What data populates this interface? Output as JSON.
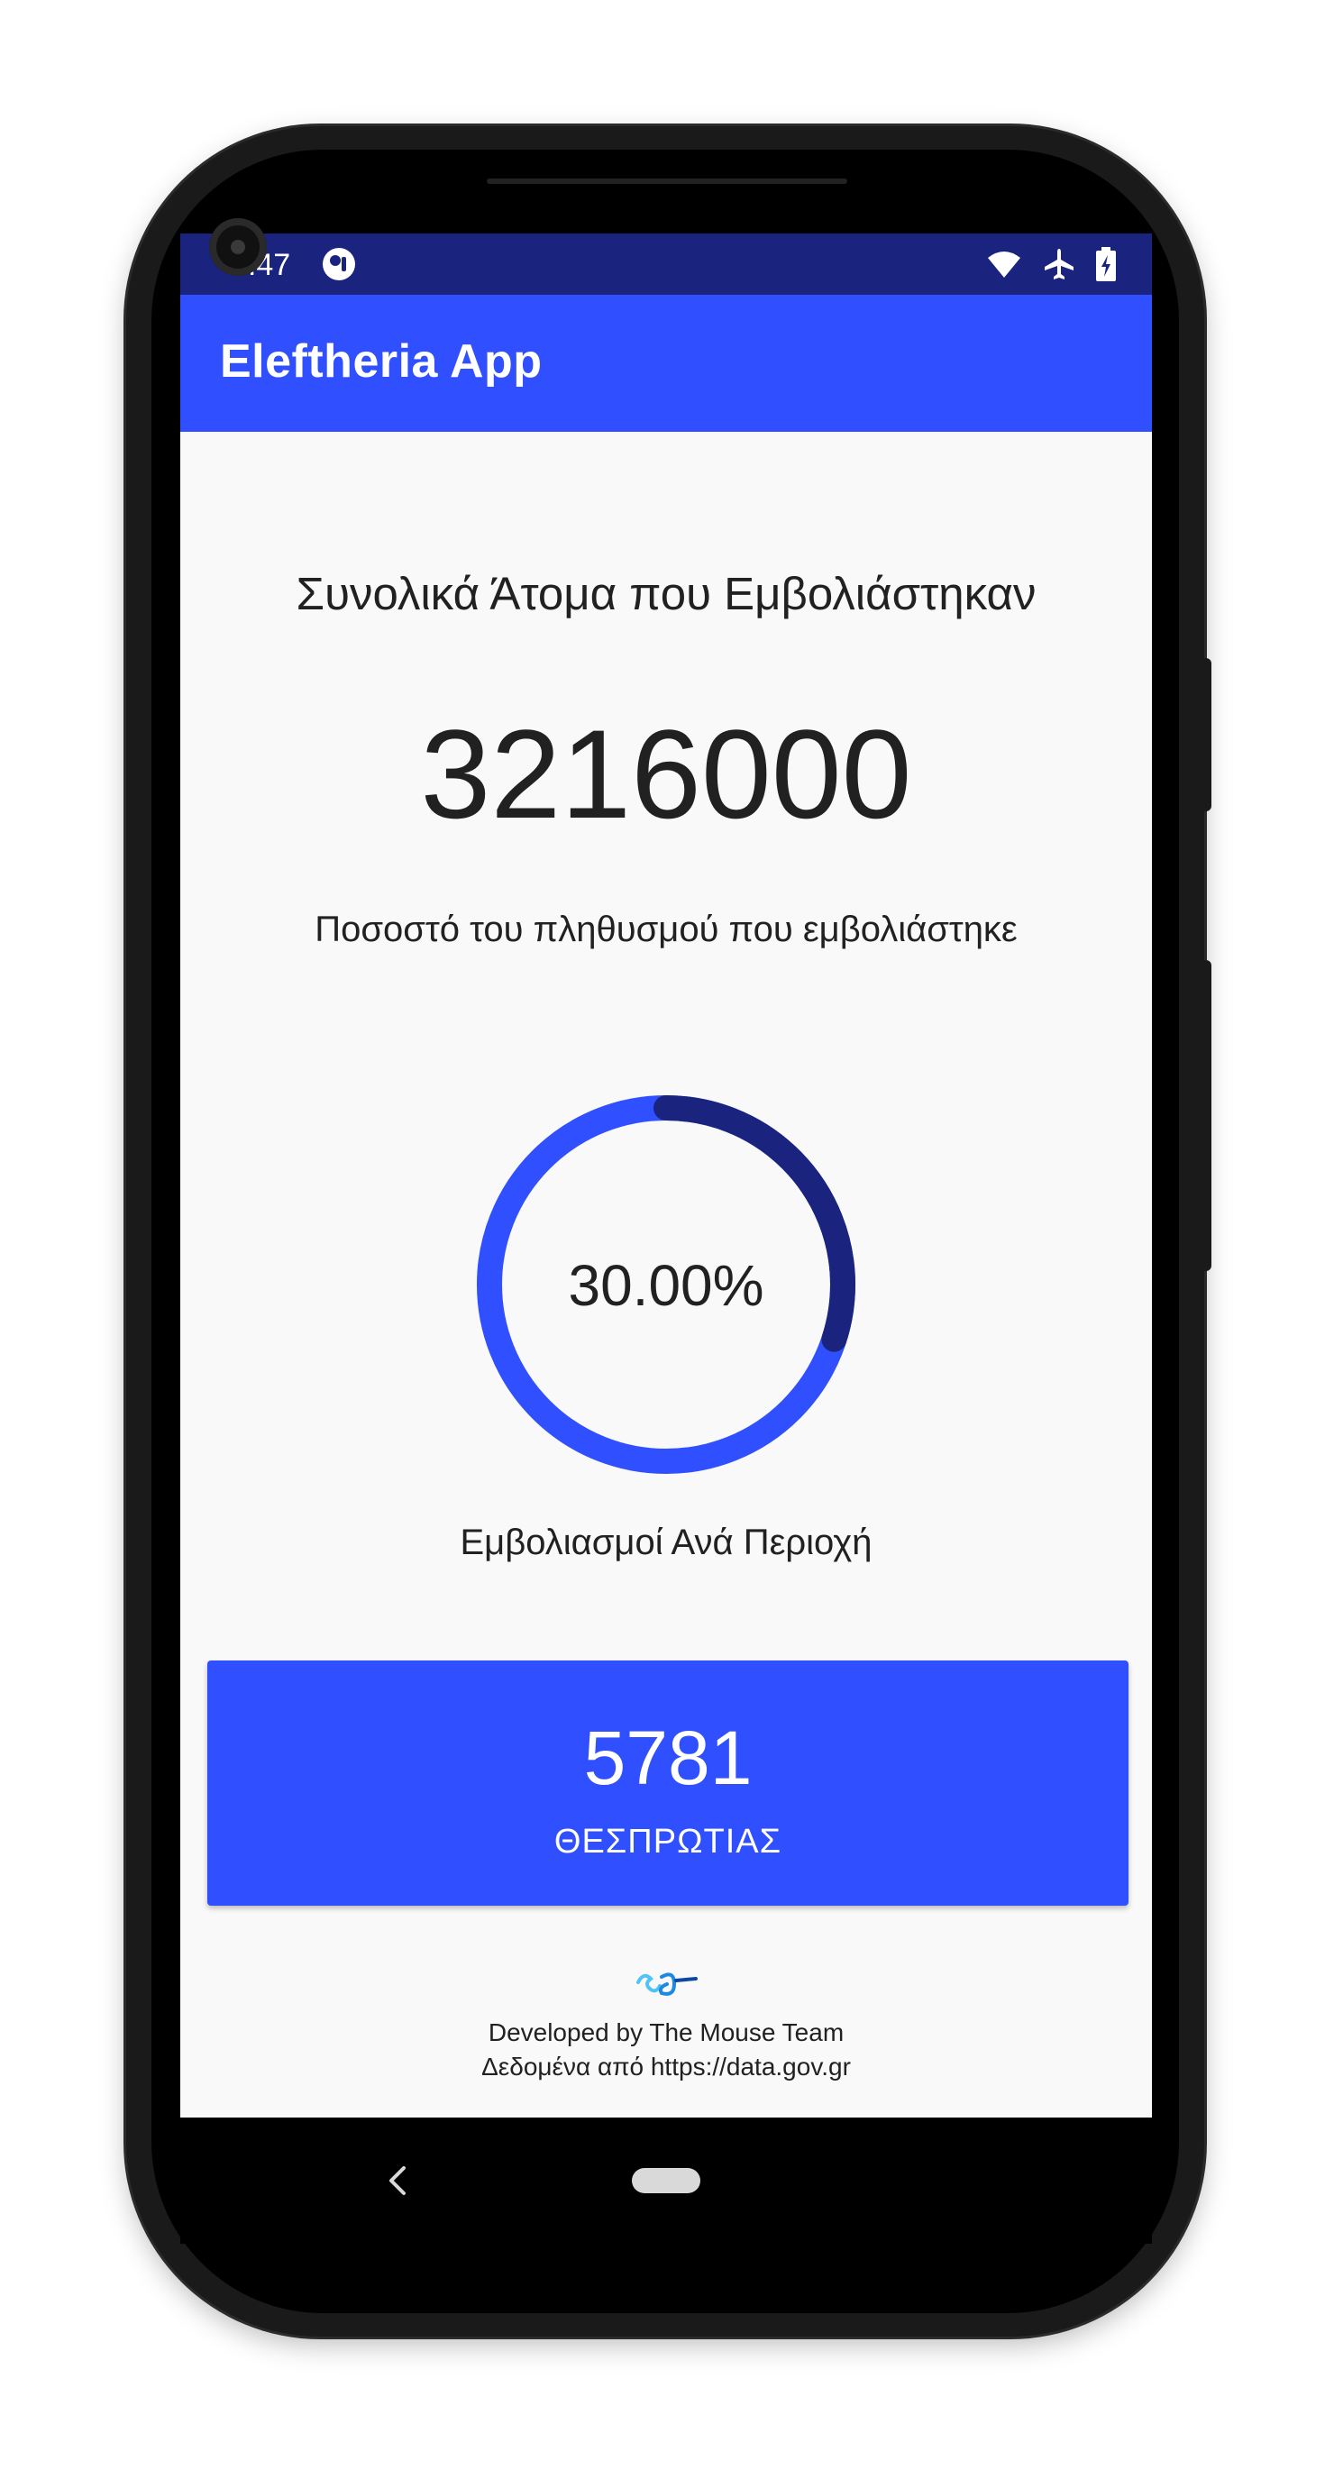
{
  "status_bar": {
    "time": "9:47"
  },
  "app_bar": {
    "title": "Eleftheria App"
  },
  "summary": {
    "total_label": "Συνολικά Άτομα που Εμβολιάστηκαν",
    "total_value": "3216000",
    "percent_label": "Ποσοστό του πληθυσμού που εμβολιάστηκε",
    "percent_value": "30.00%",
    "percent_fraction": 0.3
  },
  "regions": {
    "label": "Εμβολιασμοί Ανά Περιοχή",
    "card": {
      "count": "5781",
      "name": "ΘΕΣΠΡΩΤΙΑΣ"
    }
  },
  "footer": {
    "developed_by": "Developed by The Mouse Team",
    "data_source": "Δεδομένα από https://data.gov.gr"
  },
  "colors": {
    "primary": "#304ffe",
    "primary_dark": "#1a237e",
    "background": "#f9f9f9",
    "text": "#212121"
  },
  "icons": {
    "status_app": "circle-app-icon",
    "wifi": "wifi-icon",
    "airplane": "airplane-mode-icon",
    "battery": "battery-charging-icon",
    "back": "back-arrow-icon",
    "home": "home-pill-icon",
    "team_logo": "mouse-team-logo"
  }
}
